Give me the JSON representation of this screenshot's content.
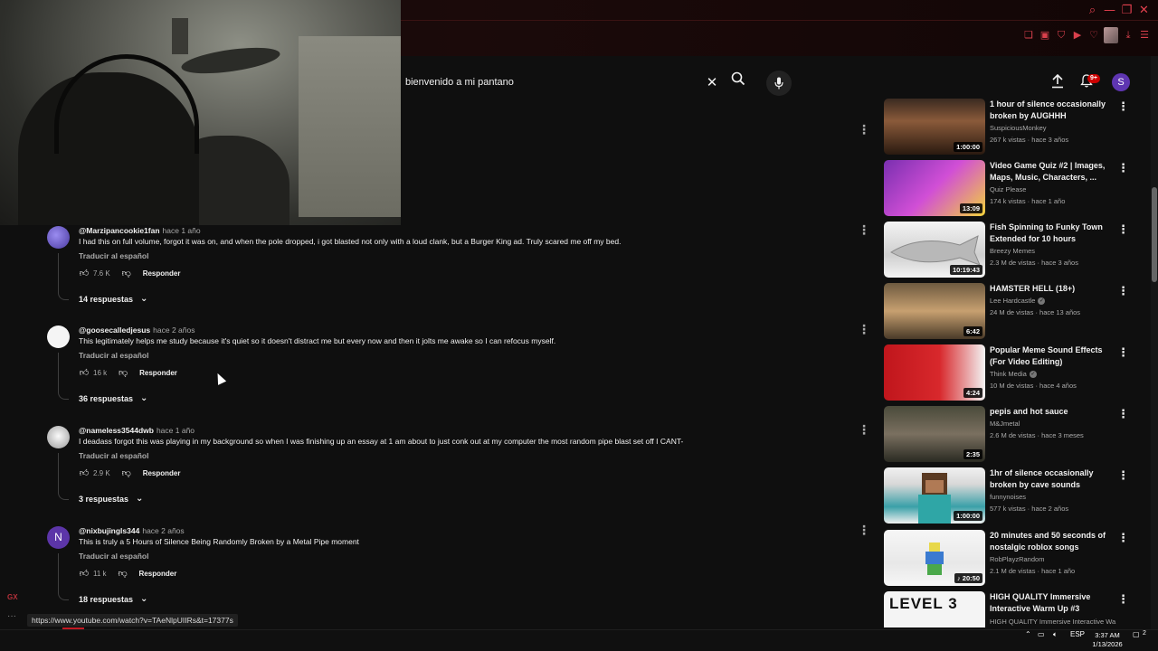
{
  "browser": {
    "window_controls": [
      "⌕",
      "—",
      "❐",
      "✕"
    ],
    "toolbar_icons": [
      "❏",
      "▣",
      "⛉",
      "▶",
      "♡",
      "⤓",
      "☰"
    ],
    "accent": "#e2404e"
  },
  "header": {
    "search_value": "bienvenido a mi pantano",
    "notification_count": "9+",
    "avatar_letter": "S",
    "avatar_color": "#5e35b1"
  },
  "comments": [
    {
      "user": "@Marzipancookie1fan",
      "time": "hace 1 año",
      "text": "I had this on full volume, forgot it was on, and when the pole dropped, i got blasted not only with a loud clank, but a Burger King ad. Truly scared me off my bed.",
      "translate": "Traducir al español",
      "likes": "7.6 K",
      "reply_label": "Responder",
      "replies": "14 respuestas",
      "avatar_color": "#6a5acd"
    },
    {
      "user": "@goosecalledjesus",
      "time": "hace 2 años",
      "text": "This legitimately helps me study because it's quiet so it doesn't distract me but every now and then it jolts me awake so I can refocus myself.",
      "translate": "Traducir al español",
      "likes": "16 k",
      "reply_label": "Responder",
      "replies": "36 respuestas",
      "avatar_color": "#f5f5f5"
    },
    {
      "user": "@nameless3544dwb",
      "time": "hace 1 año",
      "text": "I deadass forgot this was playing in my background so when I was finishing up an essay at 1 am about to just conk out at my computer the most random pipe blast set off I CANT-",
      "translate": "Traducir al español",
      "likes": "2.9 K",
      "reply_label": "Responder",
      "replies": "3 respuestas",
      "avatar_color": "#dcdcdc"
    },
    {
      "user": "@nixbujingls344",
      "time": "hace 2 años",
      "text": "This is truly a 5 Hours of Silence Being Randomly Broken by a Metal Pipe moment",
      "translate": "Traducir al español",
      "likes": "11 k",
      "reply_label": "Responder",
      "replies": "18 respuestas",
      "avatar_letter": "N",
      "avatar_color": "#5c35a8"
    }
  ],
  "recommendations": [
    {
      "title": "1 hour of silence occasionally broken by AUGHHH",
      "channel": "SuspiciousMonkey",
      "stats": "267 k vistas · hace 3 años",
      "duration": "1:00:00",
      "thumb": "linear-gradient(180deg,#3a2a20,#8a5a3a 40%,#2a1a10)",
      "verified": false
    },
    {
      "title": "Video Game Quiz #2 | Images, Maps, Music, Characters, ...",
      "channel": "Quiz Please",
      "stats": "174 k vistas · hace 1 año",
      "duration": "13:09",
      "thumb": "linear-gradient(135deg,#7a2fb0,#d14fd6 50%,#f2d23a)",
      "verified": false
    },
    {
      "title": "Fish Spinning to Funky Town Extended for 10 hours",
      "channel": "Breezy Memes",
      "stats": "2.3 M de vistas · hace 3 años",
      "duration": "10:19:43",
      "thumb": "linear-gradient(180deg,#f4f4f4,#cfcfcf 60%,#f4f4f4)",
      "verified": false
    },
    {
      "title": "HAMSTER HELL (18+)",
      "channel": "Lee Hardcastle",
      "stats": "24 M de vistas · hace 13 años",
      "duration": "6:42",
      "thumb": "linear-gradient(180deg,#6e5a40,#c7a070 50%,#4a3a28)",
      "verified": true
    },
    {
      "title": "Popular Meme Sound Effects (For Video Editing)",
      "channel": "Think Media",
      "stats": "10 M de vistas · hace 4 años",
      "duration": "4:24",
      "thumb": "linear-gradient(90deg,#c0161c,#d8282c 55%,#f3f3f3)",
      "verified": true
    },
    {
      "title": "pepis and hot sauce",
      "channel": "M&Jmetal",
      "stats": "2.6 M de vistas · hace 3 meses",
      "duration": "2:35",
      "thumb": "linear-gradient(180deg,#4a4a3a,#7a7060 50%,#2a2a22)",
      "verified": false
    },
    {
      "title": "1hr of silence occasionally broken by cave sounds",
      "channel": "funnynoises",
      "stats": "577 k vistas · hace 2 años",
      "duration": "1:00:00",
      "thumb": "linear-gradient(180deg,#f0f0f0,#d8d8d8 30%,#3aa0a8 70%,#f0f0f0)",
      "verified": false
    },
    {
      "title": "20 minutes and 50 seconds of nostalgic roblox songs",
      "channel": "RobPlayzRandom",
      "stats": "2.1 M de vistas · hace 1 año",
      "duration": "♪ 20:50",
      "thumb": "linear-gradient(180deg,#f6f6f6,#e8e8e8 60%,#f6f6f6)",
      "verified": false
    },
    {
      "title": "HIGH QUALITY Immersive Interactive Warm Up #3",
      "channel": "HIGH QUALITY Immersive Interactive Wa...",
      "stats": "",
      "duration": "",
      "thumb_text": "LEVEL 3",
      "thumb": "linear-gradient(180deg,#f4f4f4,#f4f4f4)",
      "verified": false
    }
  ],
  "status_url": "https://www.youtube.com/watch?v=TAeNlpUIIRs&t=17377s",
  "taskbar": {
    "lang": "ESP",
    "time": "3:37 AM",
    "date": "1/13/2026",
    "notif_count": "2",
    "gx_label": "GX"
  }
}
